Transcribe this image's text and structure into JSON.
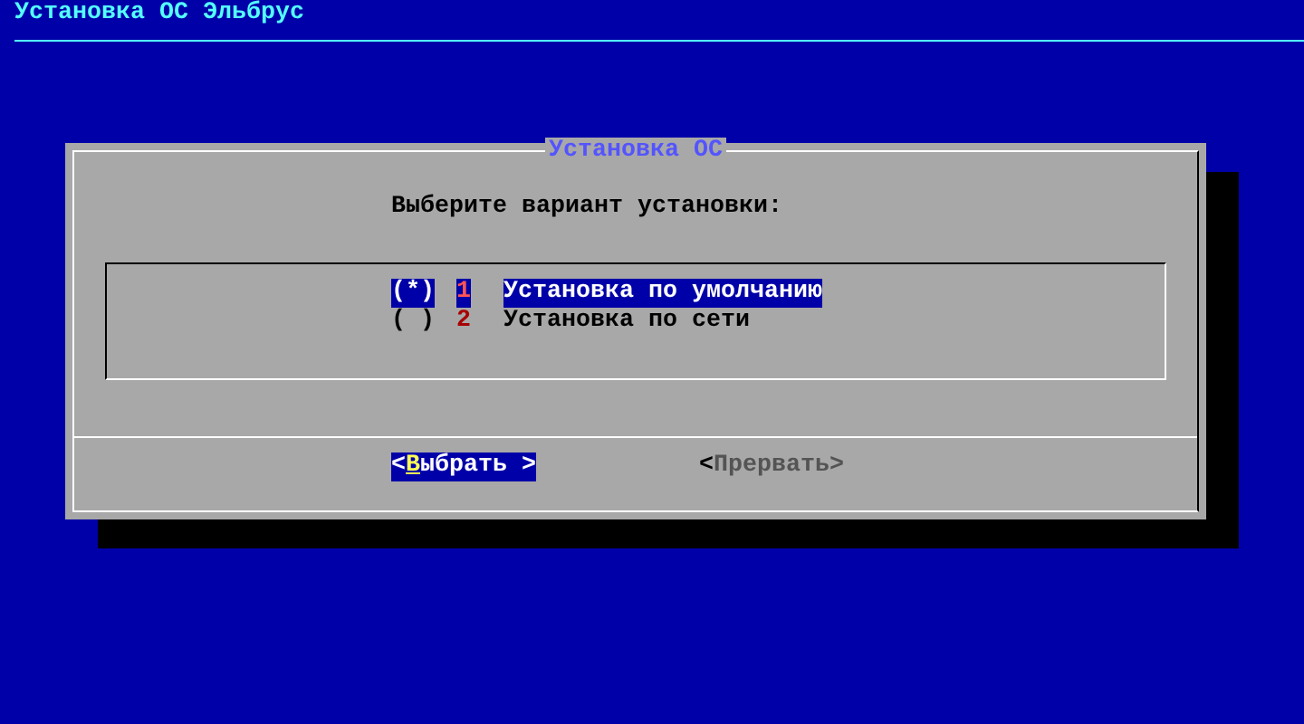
{
  "backtitle": "Установка ОС Эльбрус",
  "dialog": {
    "title": "Установка ОС",
    "prompt": "Выберите вариант установки:",
    "options": [
      {
        "marker": "(*)",
        "key": "1",
        "label": "Установка по умолчанию",
        "selected": true
      },
      {
        "marker": "( )",
        "key": "2",
        "label": "Установка по сети",
        "selected": false
      }
    ],
    "buttons": [
      {
        "prefix": "<",
        "hotkey": "В",
        "text": "ыбрать >",
        "selected": true,
        "disabled": false
      },
      {
        "prefix": "<",
        "text": "Прервать>",
        "selected": false,
        "disabled": true
      }
    ]
  }
}
